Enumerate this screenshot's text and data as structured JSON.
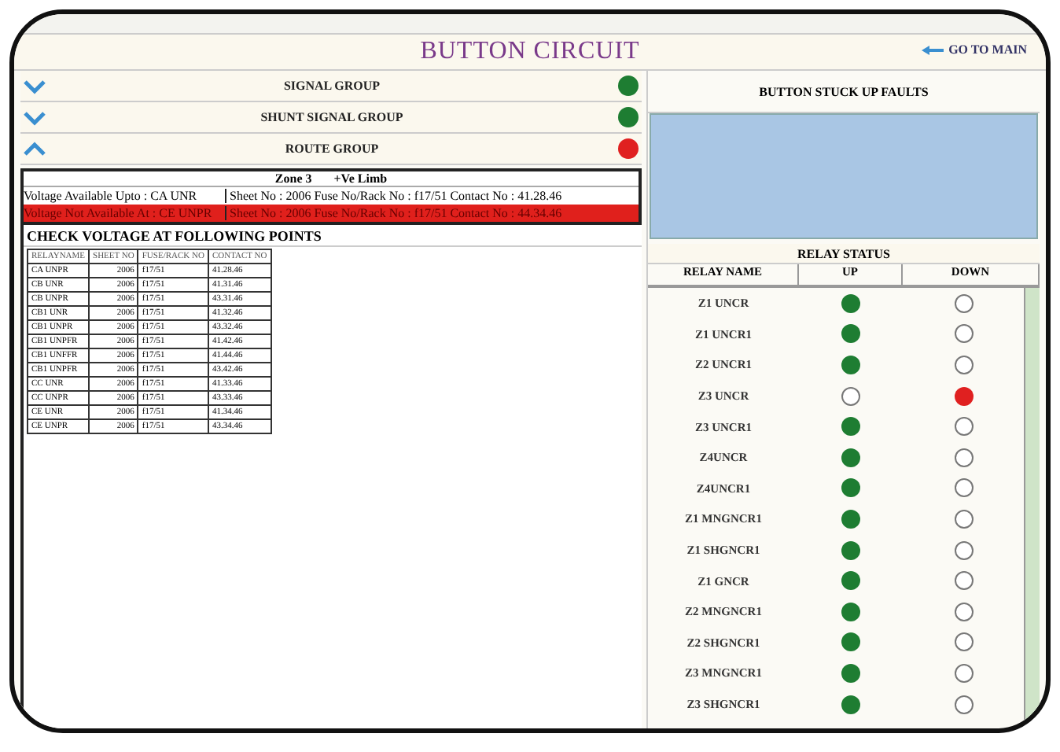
{
  "title": "BUTTON CIRCUIT",
  "go_to_main": "GO TO MAIN",
  "groups": [
    {
      "label": "SIGNAL GROUP",
      "expanded": false,
      "fault": false
    },
    {
      "label": "SHUNT SIGNAL GROUP",
      "expanded": false,
      "fault": false
    },
    {
      "label": "ROUTE GROUP",
      "expanded": true,
      "fault": true
    }
  ],
  "zone": {
    "heading": "Zone 3",
    "limb": "+Ve Limb",
    "rows": [
      {
        "fault": false,
        "location": "Voltage Available Upto : CA UNR",
        "detail": "Sheet No : 2006 Fuse No/Rack No : f17/51 Contact No : 41.28.46"
      },
      {
        "fault": true,
        "location": "Voltage Not Available At : CE UNPR",
        "detail": "Sheet No : 2006 Fuse No/Rack No : f17/51 Contact No : 44.34.46"
      }
    ]
  },
  "check": {
    "heading": "CHECK VOLTAGE AT FOLLOWING POINTS",
    "columns": [
      "RELAYNAME",
      "SHEET NO",
      "FUSE/RACK NO",
      "CONTACT NO"
    ],
    "rows": [
      [
        "CA UNPR",
        "2006",
        "f17/51",
        "41.28.46"
      ],
      [
        "CB UNR",
        "2006",
        "f17/51",
        "41.31.46"
      ],
      [
        "CB UNPR",
        "2006",
        "f17/51",
        "43.31.46"
      ],
      [
        "CB1 UNR",
        "2006",
        "f17/51",
        "41.32.46"
      ],
      [
        "CB1 UNPR",
        "2006",
        "f17/51",
        "43.32.46"
      ],
      [
        "CB1 UNPFR",
        "2006",
        "f17/51",
        "41.42.46"
      ],
      [
        "CB1 UNFFR",
        "2006",
        "f17/51",
        "41.44.46"
      ],
      [
        "CB1 UNPFR",
        "2006",
        "f17/51",
        "43.42.46"
      ],
      [
        "CC UNR",
        "2006",
        "f17/51",
        "41.33.46"
      ],
      [
        "CC UNPR",
        "2006",
        "f17/51",
        "43.33.46"
      ],
      [
        "CE UNR",
        "2006",
        "f17/51",
        "41.34.46"
      ],
      [
        "CE UNPR",
        "2006",
        "f17/51",
        "43.34.46"
      ]
    ]
  },
  "stuck_faults": {
    "heading": "BUTTON STUCK UP FAULTS"
  },
  "relay_status": {
    "heading": "RELAY STATUS",
    "columns": [
      "RELAY NAME",
      "UP",
      "DOWN"
    ],
    "rows": [
      {
        "name": "Z1 UNCR",
        "up": true,
        "down": false
      },
      {
        "name": "Z1 UNCR1",
        "up": true,
        "down": false
      },
      {
        "name": "Z2 UNCR1",
        "up": true,
        "down": false
      },
      {
        "name": "Z3 UNCR",
        "up": false,
        "down": true
      },
      {
        "name": "Z3 UNCR1",
        "up": true,
        "down": false
      },
      {
        "name": "Z4UNCR",
        "up": true,
        "down": false
      },
      {
        "name": "Z4UNCR1",
        "up": true,
        "down": false
      },
      {
        "name": "Z1 MNGNCR1",
        "up": true,
        "down": false
      },
      {
        "name": "Z1 SHGNCR1",
        "up": true,
        "down": false
      },
      {
        "name": "Z1 GNCR",
        "up": true,
        "down": false
      },
      {
        "name": "Z2 MNGNCR1",
        "up": true,
        "down": false
      },
      {
        "name": "Z2 SHGNCR1",
        "up": true,
        "down": false
      },
      {
        "name": "Z3 MNGNCR1",
        "up": true,
        "down": false
      },
      {
        "name": "Z3 SHGNCR1",
        "up": true,
        "down": false
      }
    ]
  }
}
